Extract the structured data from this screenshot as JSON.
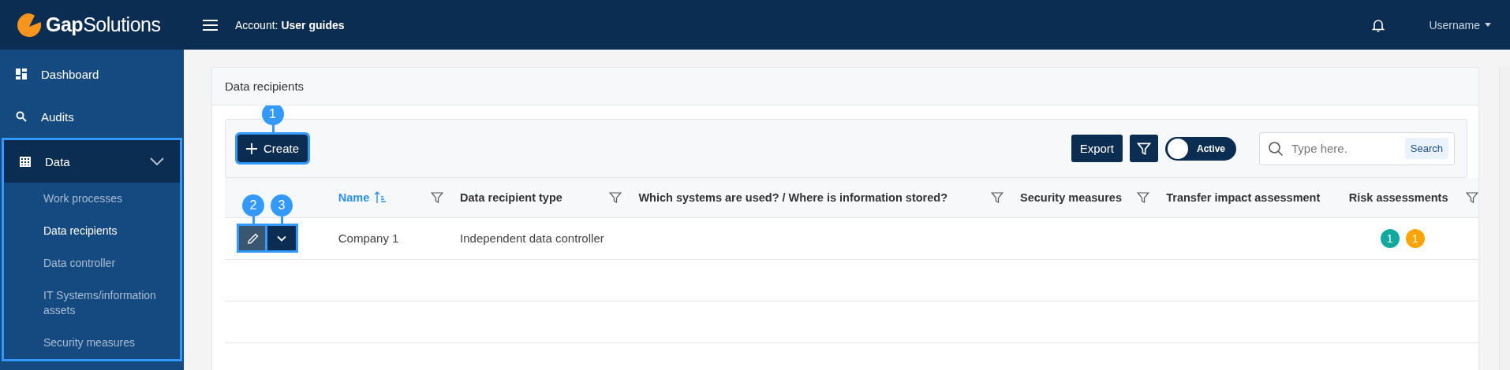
{
  "header": {
    "logo": "**Gap**Solutions",
    "account": "Account: **User guides**",
    "user": "Username"
  },
  "sidebar": {
    "items": [
      {
        "label": "Dashboard"
      },
      {
        "label": "Audits"
      },
      {
        "label": "Data",
        "expanded": true,
        "highlighted": true,
        "children": [
          {
            "label": "Work processes",
            "selected": false
          },
          {
            "label": "Data recipients",
            "selected": true
          },
          {
            "label": "Data controller",
            "selected": false
          },
          {
            "label": "IT Systems/information assets",
            "selected": false
          },
          {
            "label": "Security measures",
            "selected": false
          }
        ]
      }
    ]
  },
  "panel": {
    "title": "Data recipients"
  },
  "toolbar": {
    "create": {
      "label": "Create",
      "annotation": "1",
      "highlighted": true
    },
    "export": {
      "label": "Export"
    },
    "toggle": {
      "label": "Active",
      "on": true
    },
    "search": {
      "placeholder": "Type here.",
      "button": "Search"
    }
  },
  "table": {
    "columns": [
      {
        "label": "Name",
        "sorted": true,
        "filter": true
      },
      {
        "label": "Data recipient type",
        "sorted": false,
        "filter": true
      },
      {
        "label": "Which systems are used? / Where is information stored?",
        "sorted": false,
        "filter": true
      },
      {
        "label": "Security measures",
        "sorted": false,
        "filter": true
      },
      {
        "label": "Transfer impact assessment",
        "sorted": false,
        "filter": false
      },
      {
        "label": "Risk assessments",
        "sorted": false,
        "filter": true
      }
    ],
    "row_actions": [
      {
        "kind": "edit",
        "annotation": "2",
        "highlighted": true
      },
      {
        "kind": "menu",
        "annotation": "3",
        "highlighted": true
      }
    ],
    "rows": [
      {
        "name": "Company 1",
        "type": "Independent data controller",
        "risk_badges": [
          {
            "label": "1",
            "color": "#13a89e"
          },
          {
            "label": "1",
            "color": "#ffa500"
          }
        ]
      }
    ]
  }
}
